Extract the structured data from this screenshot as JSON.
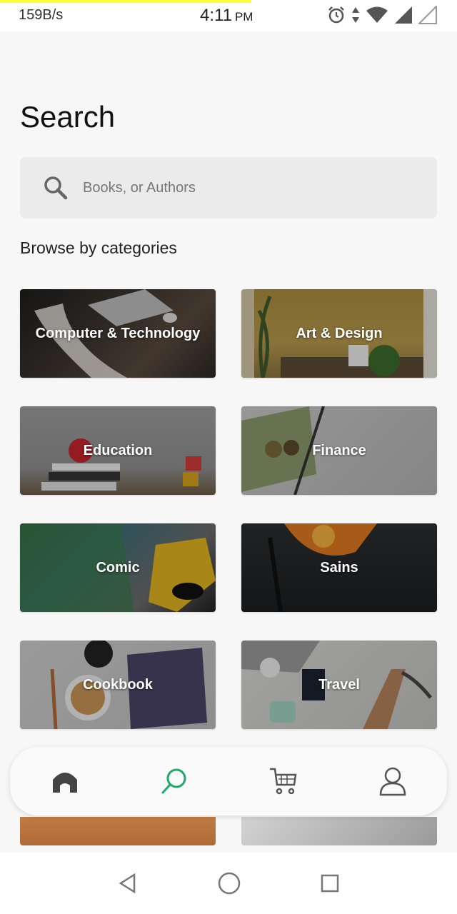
{
  "status_bar": {
    "speed": "159B/s",
    "time": "4:11",
    "ampm": "PM",
    "icons": [
      "alarm-icon",
      "data-arrows-icon",
      "wifi-icon",
      "signal-icon",
      "signal-empty-icon"
    ]
  },
  "page": {
    "title": "Search"
  },
  "search": {
    "placeholder": "Books, or Authors",
    "icon": "search-icon"
  },
  "categories_title": "Browse by categories",
  "categories": [
    {
      "label": "Computer & Technology"
    },
    {
      "label": "Art & Design"
    },
    {
      "label": "Education"
    },
    {
      "label": "Finance"
    },
    {
      "label": "Comic"
    },
    {
      "label": "Sains"
    },
    {
      "label": "Cookbook"
    },
    {
      "label": "Travel"
    }
  ],
  "bottom_nav": [
    {
      "name": "home-icon",
      "active": false
    },
    {
      "name": "search-icon",
      "active": true
    },
    {
      "name": "cart-icon",
      "active": false
    },
    {
      "name": "profile-icon",
      "active": false
    }
  ],
  "colors": {
    "accent": "#1faa6b",
    "status_accent": "#ffff33"
  }
}
